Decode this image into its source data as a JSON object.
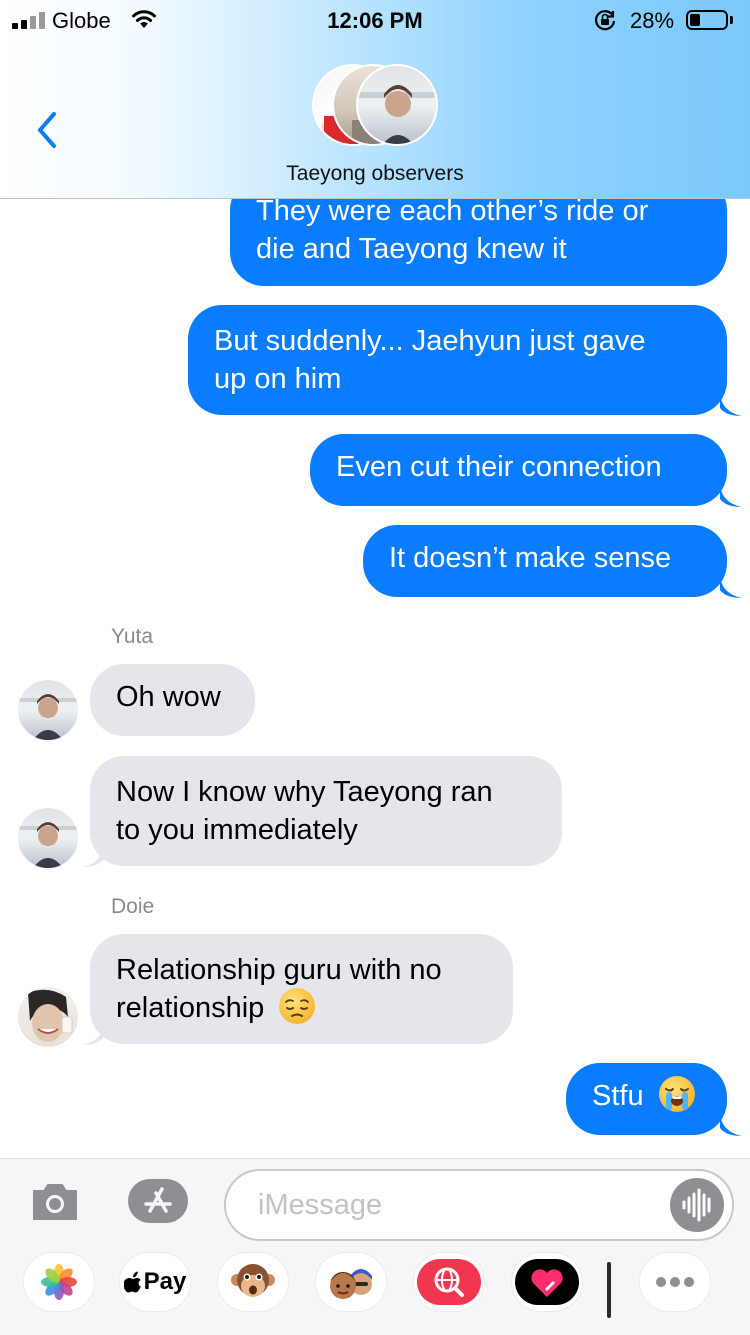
{
  "status_bar": {
    "carrier": "Globe",
    "time": "12:06 PM",
    "battery_percent": "28%",
    "battery_level": 0.28,
    "signal_bars_filled": 2,
    "signal_bars_total": 4
  },
  "conversation": {
    "title": "Taeyong observers"
  },
  "messages": [
    {
      "direction": "outgoing",
      "lines": [
        "They were each other’s ride or",
        "die and Taeyong knew it"
      ]
    },
    {
      "direction": "outgoing",
      "lines": [
        "But suddenly... Jaehyun just gave",
        "up on him"
      ]
    },
    {
      "direction": "outgoing",
      "lines": [
        "Even cut their connection"
      ]
    },
    {
      "direction": "outgoing",
      "lines": [
        "It doesn’t make sense"
      ]
    },
    {
      "direction": "incoming",
      "sender": "Yuta",
      "lines": [
        "Oh wow"
      ]
    },
    {
      "direction": "incoming",
      "lines": [
        "Now I know why Taeyong ran",
        "to you immediately"
      ]
    },
    {
      "direction": "incoming",
      "sender": "Doie",
      "lines": [
        "Relationship guru with no",
        "relationship"
      ],
      "emoji": "pensive-face"
    },
    {
      "direction": "outgoing",
      "lines": [
        "Stfu"
      ],
      "emoji": "loudly-crying-face"
    }
  ],
  "composer": {
    "placeholder": "iMessage"
  },
  "app_drawer": {
    "apple_pay_label": "Pay",
    "items": [
      "photos-app",
      "apple-pay",
      "animoji",
      "memoji-stickers",
      "web-images-search",
      "digital-touch",
      "more"
    ]
  },
  "colors": {
    "outgoing_bubble": "#0a7cff",
    "incoming_bubble": "#e6e5eb",
    "back_chevron": "#0a7cff"
  }
}
